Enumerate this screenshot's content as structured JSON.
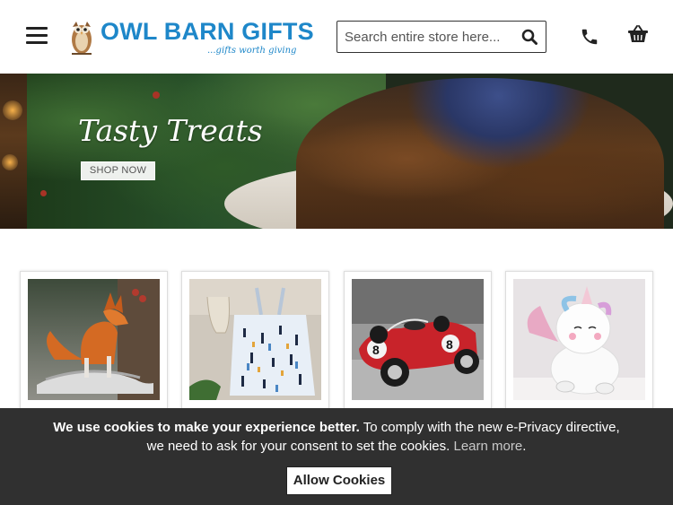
{
  "header": {
    "menu_icon": "hamburger-menu-icon",
    "logo": {
      "title": "OWL BARN GIFTS",
      "tagline": "...gifts worth giving",
      "brand_color": "#1e87c9"
    },
    "search": {
      "placeholder": "Search entire store here...",
      "value": "",
      "icon": "search-icon"
    },
    "phone_icon": "phone-icon",
    "basket_icon": "basket-icon"
  },
  "banner": {
    "title": "Tasty Treats",
    "cta_label": "SHOP NOW"
  },
  "products": [
    {
      "image": "silver-fox-figurine"
    },
    {
      "image": "printed-tote-bag"
    },
    {
      "image": "red-vintage-race-car"
    },
    {
      "image": "unicorn-figure"
    }
  ],
  "cookie_bar": {
    "bold_text": "We use cookies to make your experience better.",
    "text": " To comply with the new e-Privacy directive, we need to ask for your consent to set the cookies. ",
    "link_label": "Learn more",
    "trailing": ".",
    "button_label": "Allow Cookies",
    "background": "#303030"
  }
}
